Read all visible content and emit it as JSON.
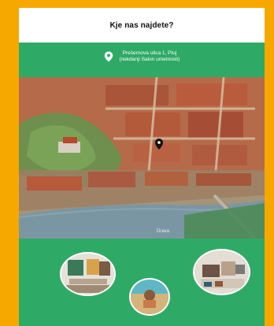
{
  "header": {
    "title": "Kje nas najdete?"
  },
  "address": {
    "line1": "Prešernova ulica 1, Ptuj",
    "line2": "(nekdanji Salon umetnosti)",
    "icon": "location-pin-icon"
  },
  "map": {
    "river_label": "Drava",
    "marker_icon": "location-pin-icon"
  },
  "colors": {
    "background": "#f7a800",
    "card_green": "#2faa66",
    "header_white": "#ffffff"
  },
  "photos": [
    {
      "name": "photo-gallery-exhibit-1"
    },
    {
      "name": "photo-gallery-exhibit-2"
    },
    {
      "name": "photo-gallery-exhibit-3"
    }
  ]
}
